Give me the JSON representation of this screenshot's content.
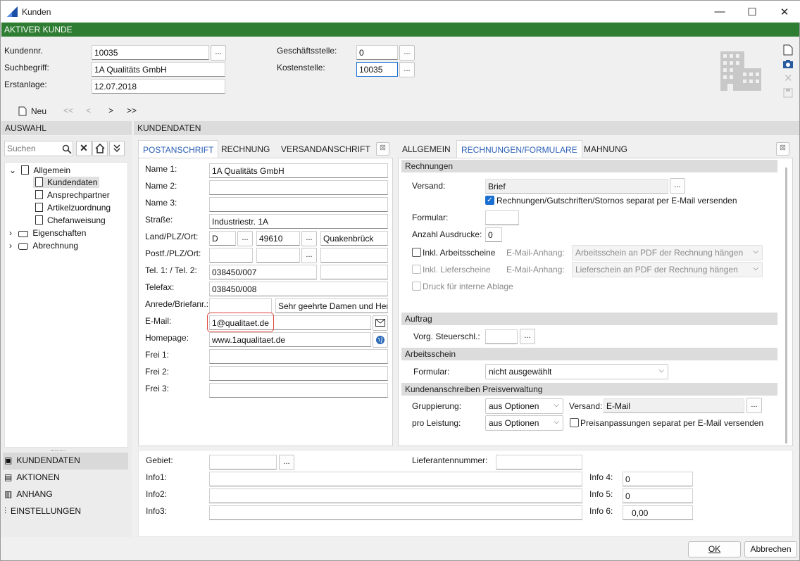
{
  "window": {
    "title": "Kunden",
    "min": "—",
    "max": "☐",
    "close": "✕"
  },
  "banner": "AKTIVER KUNDE",
  "header": {
    "kundennr_label": "Kundennr.",
    "kundennr": "10035",
    "suchbegriff_label": "Suchbegriff:",
    "suchbegriff": "1A Qualitäts GmbH",
    "erstanlage_label": "Erstanlage:",
    "erstanlage": "12.07.2018",
    "geschaeftsstelle_label": "Geschäftsstelle:",
    "geschaeftsstelle": "0",
    "kostenstelle_label": "Kostenstelle:",
    "kostenstelle": "10035",
    "dots": "..."
  },
  "toolbar": {
    "neu": "Neu",
    "first": "<<",
    "prev": "<",
    "next": ">",
    "last": ">>"
  },
  "auswahl": {
    "title": "AUSWAHL",
    "search_placeholder": "Suchen",
    "tree": [
      {
        "label": "Allgemein"
      },
      {
        "label": "Kundendaten"
      },
      {
        "label": "Ansprechpartner"
      },
      {
        "label": "Artikelzuordnung"
      },
      {
        "label": "Chefanweisung"
      },
      {
        "label": "Eigenschaften"
      },
      {
        "label": "Abrechnung"
      }
    ],
    "nav": [
      {
        "label": "KUNDENDATEN"
      },
      {
        "label": "AKTIONEN"
      },
      {
        "label": "ANHANG"
      },
      {
        "label": "EINSTELLUNGEN"
      }
    ]
  },
  "kundendaten": {
    "title": "KUNDENDATEN",
    "left_tabs": [
      "POSTANSCHRIFT",
      "RECHNUNG",
      "VERSANDANSCHRIFT"
    ],
    "right_tabs": [
      "ALLGEMEIN",
      "RECHNUNGEN/FORMULARE",
      "MAHNUNG"
    ],
    "address": {
      "name1_label": "Name 1:",
      "name1": "1A Qualitäts GmbH",
      "name2_label": "Name 2:",
      "name3_label": "Name 3:",
      "strasse_label": "Straße:",
      "strasse": "Industriestr. 1A",
      "land_label": "Land/PLZ/Ort:",
      "land": "D",
      "plz": "49610",
      "ort": "Quakenbrück",
      "postf_label": "Postf./PLZ/Ort:",
      "tel_label": "Tel. 1: / Tel. 2:",
      "tel1": "038450/007",
      "telefax_label": "Telefax:",
      "telefax": "038450/008",
      "anrede_label": "Anrede/Briefanr.:",
      "briefanrede": "Sehr geehrte Damen und Herr",
      "email_label": "E-Mail:",
      "email": "1@qualitaet.de",
      "homepage_label": "Homepage:",
      "homepage": "www.1aqualitaet.de",
      "frei1_label": "Frei 1:",
      "frei2_label": "Frei 2:",
      "frei3_label": "Frei 3:"
    },
    "rechnungen": {
      "section": "Rechnungen",
      "versand_label": "Versand:",
      "versand": "Brief",
      "separat_label": "Rechnungen/Gutschriften/Stornos separat per E-Mail versenden",
      "formular_label": "Formular:",
      "anzahl_label": "Anzahl Ausdrucke:",
      "anzahl": "0",
      "arbeitsscheine_label": "Inkl. Arbeitsscheine",
      "anhang_label": "E-Mail-Anhang:",
      "arbeitsscheine_option": "Arbeitsschein an PDF der Rechnung hängen",
      "lieferscheine_label": "Inkl. Lieferscheine",
      "lieferscheine_option": "Lieferschein an PDF der Rechnung hängen",
      "druck_label": "Druck für interne Ablage"
    },
    "auftrag": {
      "section": "Auftrag",
      "steuer_label": "Vorg. Steuerschl.:"
    },
    "arbeitsschein": {
      "section": "Arbeitsschein",
      "formular_label": "Formular:",
      "formular": "nicht ausgewählt"
    },
    "preis": {
      "section": "Kundenanschreiben Preisverwaltung",
      "gruppierung_label": "Gruppierung:",
      "gruppierung": "aus Optionen",
      "versand_label": "Versand:",
      "versand": "E-Mail",
      "leistung_label": "pro Leistung:",
      "leistung": "aus Optionen",
      "separat_label": "Preisanpassungen separat per E-Mail versenden"
    },
    "bottom": {
      "gebiet_label": "Gebiet:",
      "lieferant_label": "Lieferantennummer:",
      "info1_label": "Info1:",
      "info2_label": "Info2:",
      "info3_label": "Info3:",
      "info4_label": "Info 4:",
      "info4": "0",
      "info5_label": "Info 5:",
      "info5": "0",
      "info6_label": "Info 6:",
      "info6": "0,00"
    }
  },
  "footer": {
    "ok": "OK",
    "abbrechen": "Abbrechen"
  }
}
